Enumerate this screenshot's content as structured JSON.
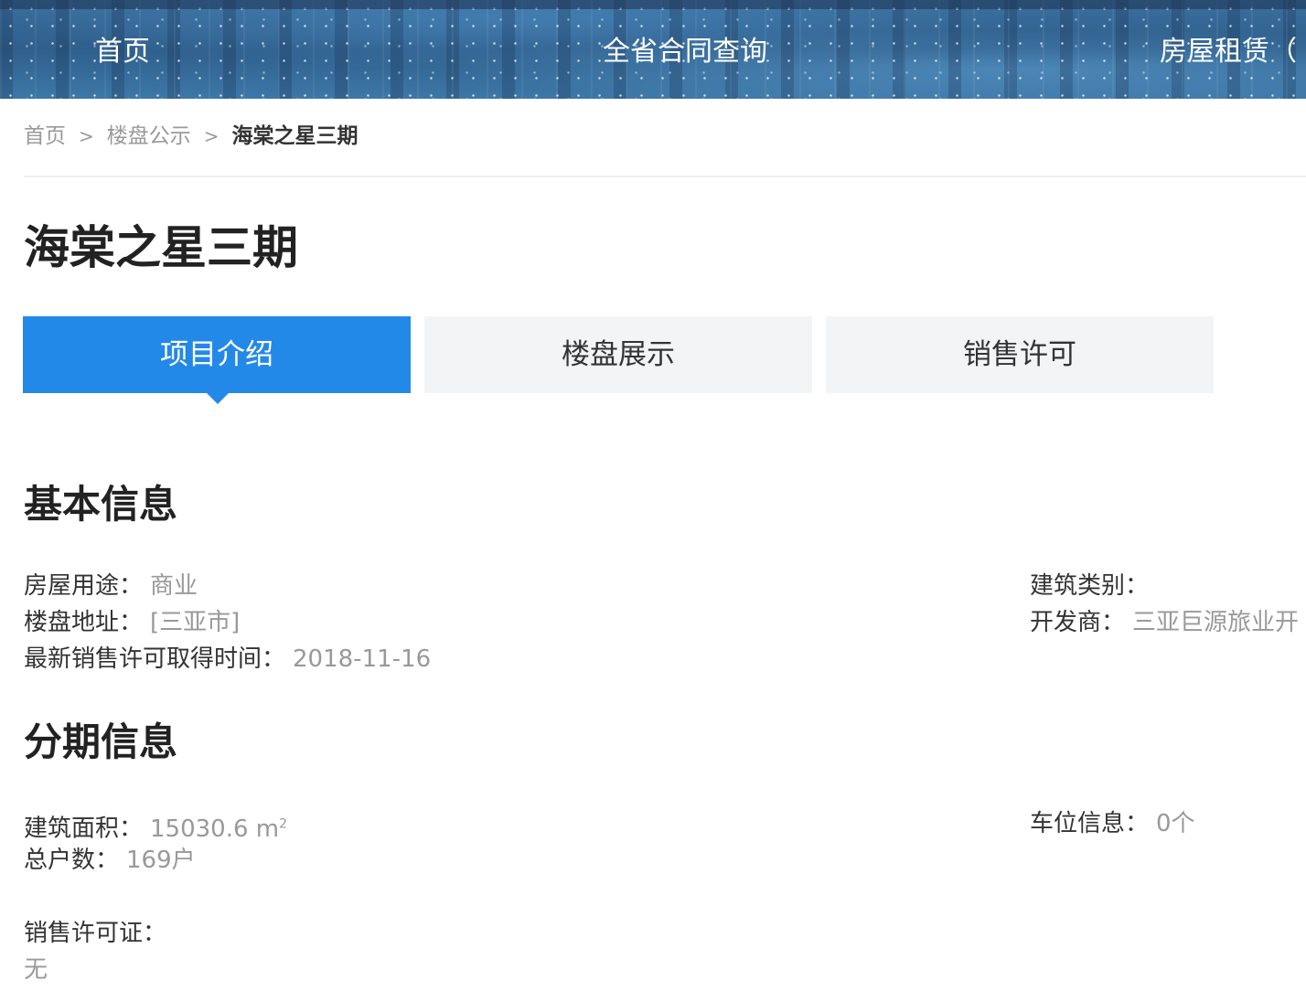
{
  "nav": {
    "items": [
      {
        "label": "首页"
      },
      {
        "label": "全省合同查询"
      },
      {
        "label": "房屋租赁（"
      }
    ]
  },
  "breadcrumb": {
    "items": [
      "首页",
      "楼盘公示"
    ],
    "separator": ">",
    "current": "海棠之星三期"
  },
  "page": {
    "title": "海棠之星三期"
  },
  "tabs": [
    {
      "label": "项目介绍",
      "active": true
    },
    {
      "label": "楼盘展示",
      "active": false
    },
    {
      "label": "销售许可",
      "active": false
    }
  ],
  "basic_info": {
    "title": "基本信息",
    "usage_label": "房屋用途：",
    "usage_value": "商业",
    "address_label": "楼盘地址：",
    "address_value": "[三亚市]",
    "permit_time_label": "最新销售许可取得时间：",
    "permit_time_value": "2018-11-16",
    "building_type_label": "建筑类别：",
    "building_type_value": "",
    "developer_label": "开发商：",
    "developer_value": "三亚巨源旅业开"
  },
  "phase_info": {
    "title": "分期信息",
    "area_label": "建筑面积：",
    "area_value": "15030.6 m",
    "area_unit_sup": "2",
    "households_label": "总户数：",
    "households_value": "169户",
    "parking_label": "车位信息：",
    "parking_value": "0个",
    "license_label": "销售许可证：",
    "license_value": "无"
  },
  "colors": {
    "accent": "#2389e8",
    "tab_inactive_bg": "#f3f4f6",
    "muted_text": "#999999",
    "heading_text": "#222222"
  }
}
